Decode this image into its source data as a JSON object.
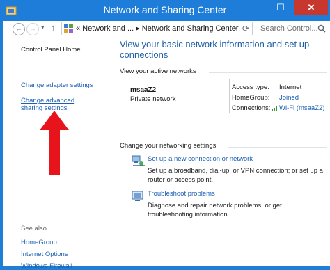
{
  "window": {
    "title": "Network and Sharing Center",
    "min_glyph": "—",
    "max_glyph": "☐",
    "close_glyph": "✕"
  },
  "address": {
    "back_glyph": "←",
    "forward_glyph": "→",
    "dropdown_glyph": "▾",
    "up_glyph": "↑",
    "breadcrumb": "« Network and ...  ▸  Network and Sharing Center",
    "breadcrumb_caret": "▾",
    "refresh_glyph": "⟳",
    "search_placeholder": "Search Control..."
  },
  "sidebar": {
    "home": "Control Panel Home",
    "adapter": "Change adapter settings",
    "advanced": "Change advanced sharing settings",
    "see_also": "See also",
    "homegroup": "HomeGroup",
    "internet_options": "Internet Options",
    "firewall": "Windows Firewall"
  },
  "main": {
    "heading": "View your basic network information and set up connections",
    "active_label": "View your active networks",
    "network": {
      "name": "msaaZ2",
      "type": "Private network",
      "access_key": "Access type:",
      "access_val": "Internet",
      "homegroup_key": "HomeGroup:",
      "homegroup_val": "Joined",
      "connections_key": "Connections:",
      "connections_val": "Wi-Fi (msaaZ2)"
    },
    "change_label": "Change your networking settings",
    "tasks": [
      {
        "title": "Set up a new connection or network",
        "desc": "Set up a broadband, dial-up, or VPN connection; or set up a router or access point."
      },
      {
        "title": "Troubleshoot problems",
        "desc": "Diagnose and repair network problems, or get troubleshooting information."
      }
    ]
  },
  "colors": {
    "accent": "#1e7dd8",
    "link": "#1a5fb4",
    "heading": "#1e5fa8",
    "annotation_arrow": "#e8141b"
  },
  "icons": [
    "network-folder-icon",
    "search-icon",
    "wifi-signal-icon",
    "new-connection-icon",
    "troubleshoot-icon",
    "red-arrow-annotation"
  ]
}
